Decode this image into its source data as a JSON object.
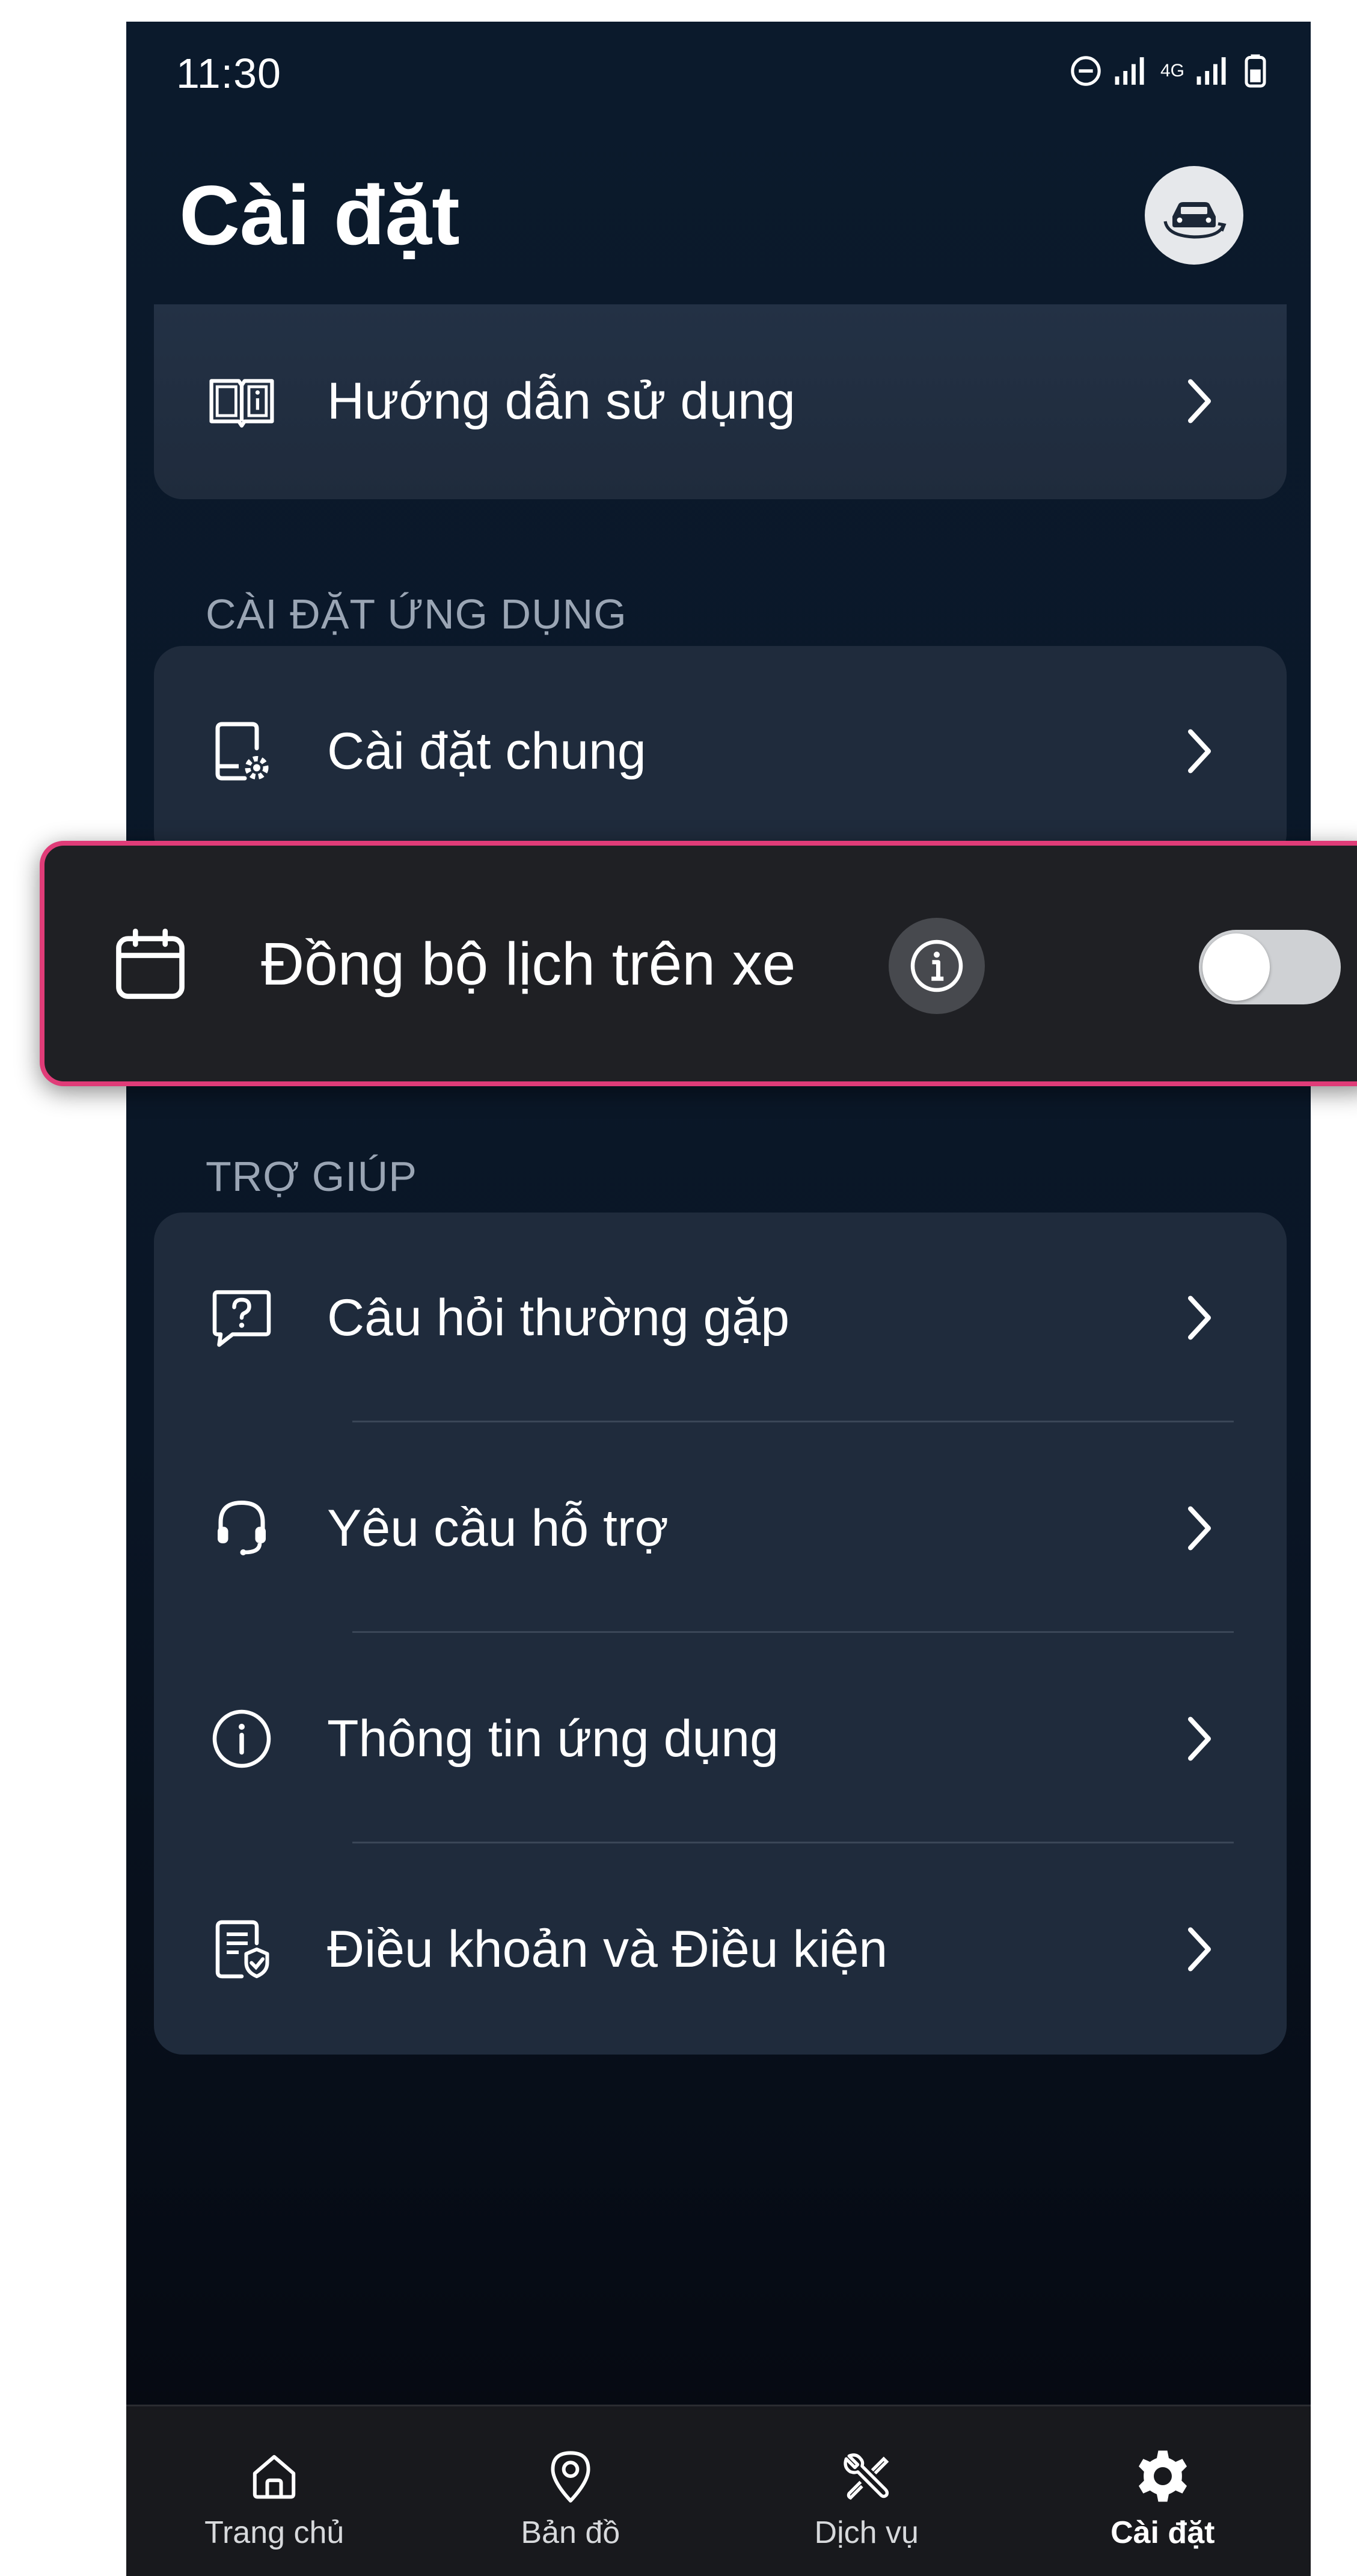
{
  "status_bar": {
    "time": "11:30",
    "network_label": "4G"
  },
  "header": {
    "title": "Cài đặt",
    "avatar_icon": "car-sync-icon"
  },
  "top_card": {
    "items": [
      {
        "label": "Hướng dẫn sử dụng",
        "icon": "book-icon"
      }
    ]
  },
  "app_settings": {
    "section_title": "CÀI ĐẶT ỨNG DỤNG",
    "items": [
      {
        "label": "Cài đặt chung",
        "icon": "phone-settings-icon"
      }
    ]
  },
  "calendar_sync": {
    "label": "Đồng bộ lịch trên xe",
    "icon": "calendar-icon",
    "info_icon": "info-icon",
    "toggle_on": false
  },
  "help": {
    "section_title": "TRỢ GIÚP",
    "items": [
      {
        "label": "Câu hỏi thường gặp",
        "icon": "faq-icon"
      },
      {
        "label": "Yêu cầu hỗ trợ",
        "icon": "headset-icon"
      },
      {
        "label": "Thông tin ứng dụng",
        "icon": "info-circle-icon"
      },
      {
        "label": "Điều khoản và Điều kiện",
        "icon": "document-shield-icon"
      }
    ]
  },
  "bottom_nav": {
    "items": [
      {
        "label": "Trang chủ",
        "icon": "home-icon",
        "active": false
      },
      {
        "label": "Bản đồ",
        "icon": "map-pin-icon",
        "active": false
      },
      {
        "label": "Dịch vụ",
        "icon": "tools-icon",
        "active": false
      },
      {
        "label": "Cài đặt",
        "icon": "gear-icon",
        "active": true
      }
    ]
  },
  "colors": {
    "accent_highlight": "#e03c78",
    "card_background": "#1f2b3c",
    "page_background": "#0b1a2c"
  }
}
